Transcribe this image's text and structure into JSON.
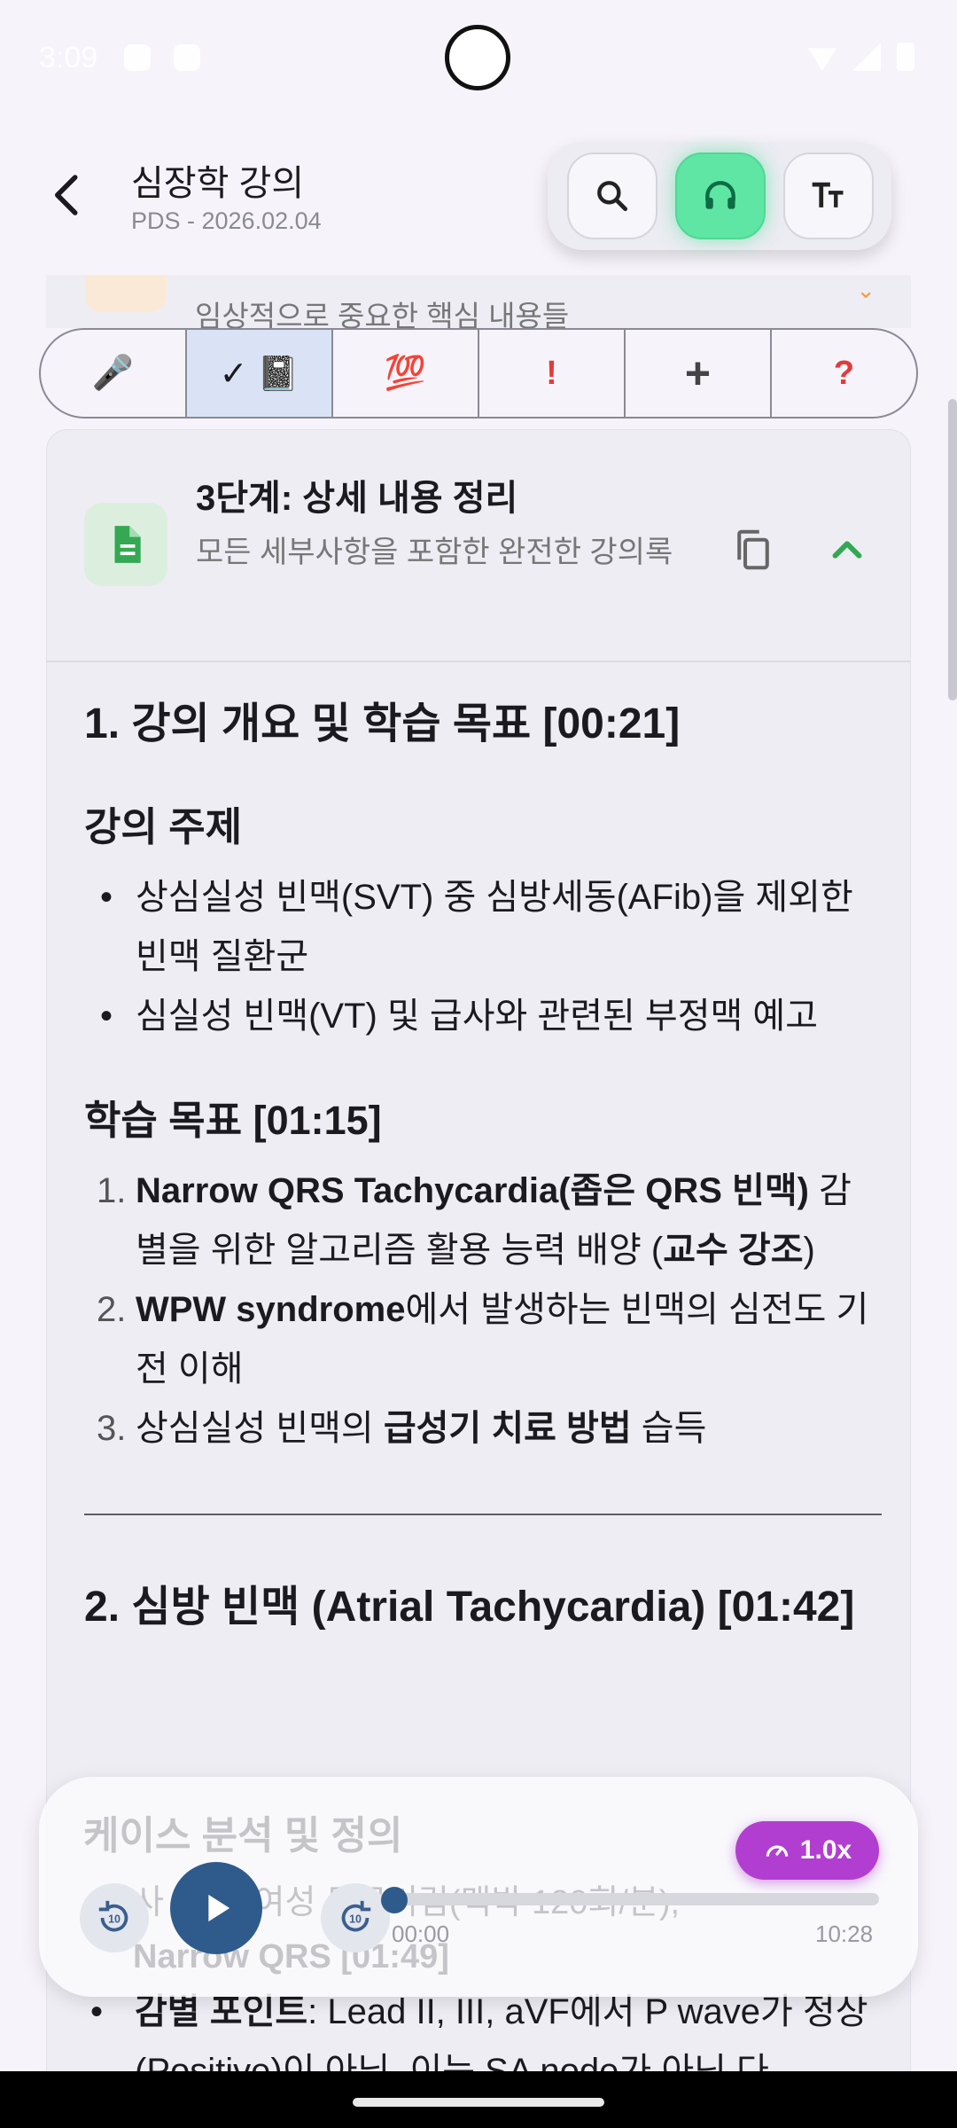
{
  "status": {
    "time": "3:09"
  },
  "header": {
    "title": "심장학 강의",
    "subtitle": "PDS - 2026.02.04"
  },
  "peek": {
    "text": "임상적으로 중요한 핵심 내용들"
  },
  "filters": [
    "🎤",
    "✓ 📓",
    "💯",
    "!",
    "+",
    "?"
  ],
  "card": {
    "title": "3단계: 상세 내용 정리",
    "description": "모든 세부사항을 포함한 완전한 강의록"
  },
  "content": {
    "section1_title": "1. 강의 개요 및 학습 목표 [00:21]",
    "topic_heading": "강의 주제",
    "topic_items": [
      "상심실성 빈맥(SVT) 중 심방세동(AFib)을 제외한 빈맥 질환군",
      "심실성 빈맥(VT) 및 급사와 관련된 부정맥 예고"
    ],
    "goals_heading": "학습 목표 [01:15]",
    "goals": [
      {
        "num": "1.",
        "bold1": "Narrow QRS Tachycardia(좁은 QRS 빈맥)",
        "text1": " 감별을 위한 알고리즘 활용 능력 배양 (",
        "bold2": "교수 강조",
        "text2": ")"
      },
      {
        "num": "2.",
        "bold1": "WPW syndrome",
        "text1": "에서 발생하는 빈맥의 심전도 기전 이해",
        "bold2": "",
        "text2": ""
      },
      {
        "num": "3.",
        "bold1": "",
        "text1": "상심실성 빈맥의 ",
        "bold2": "급성기 치료 방법",
        "text2": " 습득"
      }
    ],
    "section2_title": "2. 심방 빈맥 (Atrial Tachycardia) [01:42]",
    "ghost_heading": "케이스 분석 및 정의",
    "ghost_line1": "사 노 세 여성 두근거림(맥박 120회/분),",
    "ghost_line2": "Narrow QRS [01:49]",
    "diff_label": "감별 포인트",
    "diff_text": ": Lead II, III, aVF에서 P wave가 정상(Positive)이 아님. 이는 SA node가 아닌 다"
  },
  "player": {
    "speed": "1.0x",
    "current": "00:00",
    "duration": "10:28",
    "skip_back": "10",
    "skip_fwd": "10",
    "progress": 0
  }
}
